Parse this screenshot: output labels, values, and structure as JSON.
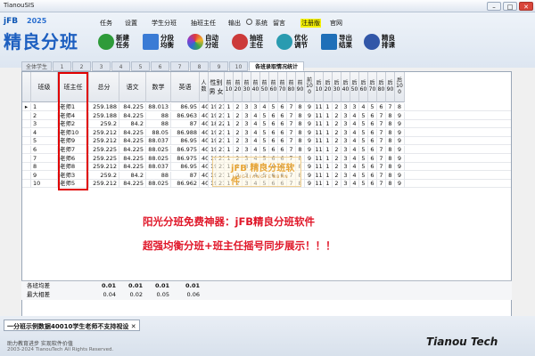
{
  "window": {
    "title": "TianouSIS",
    "min": "–",
    "max": "□",
    "close": "✕"
  },
  "logo": {
    "jfb": "jFB",
    "year": "2025",
    "name": "精良分班"
  },
  "menu": [
    "任务",
    "设置",
    "学生分班",
    "抽班主任",
    "输出",
    "系统",
    "留言",
    "注册版",
    "官网"
  ],
  "toolbar": [
    {
      "label1": "新建",
      "label2": "任务",
      "color": "#2e9b3a"
    },
    {
      "label1": "分段",
      "label2": "均衡",
      "color": "#3a7bd5"
    },
    {
      "label1": "自动",
      "label2": "分班",
      "color": "#d2a02a"
    },
    {
      "label1": "抽班",
      "label2": "主任",
      "color": "#cc3a3a"
    },
    {
      "label1": "优化",
      "label2": "调节",
      "color": "#2a9bb0"
    },
    {
      "label1": "导出",
      "label2": "结果",
      "color": "#1f6fb8"
    },
    {
      "label1": "精良",
      "label2": "排课",
      "color": "#3257a8"
    }
  ],
  "tabs": [
    "全体学生",
    "1",
    "2",
    "3",
    "4",
    "5",
    "6",
    "7",
    "8",
    "9",
    "10",
    "各班录取情况统计"
  ],
  "grid": {
    "headers": [
      "班级",
      "班主任",
      "总分",
      "语文",
      "数学",
      "英语",
      "人数",
      "性别",
      "",
      "前10",
      "前20",
      "前30",
      "前40",
      "前50",
      "前60",
      "前70",
      "前80",
      "前90",
      "前100",
      "后10",
      "后20",
      "后30",
      "后40",
      "后50",
      "后60",
      "后70",
      "后80",
      "后90",
      "后100"
    ],
    "gender": [
      "男",
      "女"
    ],
    "rows": [
      {
        "cls": "1",
        "teacher": "老师1",
        "total": "259.188",
        "yw": "84.225",
        "sx": "88.013",
        "yy": "86.95",
        "n": "40",
        "m": "19",
        "f": "21",
        "ranks": [
          "1",
          "2",
          "3",
          "3",
          "4",
          "5",
          "6",
          "7",
          "8",
          "9",
          "11",
          "1",
          "2",
          "3",
          "3",
          "4",
          "5",
          "6",
          "7",
          "8",
          "9"
        ]
      },
      {
        "cls": "2",
        "teacher": "老师4",
        "total": "259.188",
        "yw": "84.225",
        "sx": "88",
        "yy": "86.963",
        "n": "40",
        "m": "19",
        "f": "21",
        "ranks": [
          "1",
          "2",
          "3",
          "4",
          "5",
          "6",
          "6",
          "7",
          "8",
          "9",
          "11",
          "1",
          "2",
          "3",
          "4",
          "5",
          "6",
          "7",
          "8",
          "9",
          "10"
        ]
      },
      {
        "cls": "3",
        "teacher": "老师2",
        "total": "259.2",
        "yw": "84.2",
        "sx": "88",
        "yy": "87",
        "n": "40",
        "m": "18",
        "f": "22",
        "ranks": [
          "1",
          "2",
          "3",
          "4",
          "5",
          "6",
          "6",
          "7",
          "8",
          "9",
          "11",
          "1",
          "2",
          "3",
          "4",
          "5",
          "6",
          "7",
          "8",
          "9",
          "10"
        ]
      },
      {
        "cls": "4",
        "teacher": "老师10",
        "total": "259.212",
        "yw": "84.225",
        "sx": "88.05",
        "yy": "86.988",
        "n": "40",
        "m": "19",
        "f": "21",
        "ranks": [
          "1",
          "2",
          "3",
          "4",
          "5",
          "6",
          "6",
          "7",
          "8",
          "9",
          "11",
          "1",
          "2",
          "3",
          "4",
          "5",
          "6",
          "7",
          "8",
          "9",
          "10"
        ]
      },
      {
        "cls": "5",
        "teacher": "老师9",
        "total": "259.212",
        "yw": "84.225",
        "sx": "88.037",
        "yy": "86.95",
        "n": "40",
        "m": "19",
        "f": "21",
        "ranks": [
          "1",
          "2",
          "3",
          "4",
          "5",
          "6",
          "6",
          "7",
          "8",
          "9",
          "11",
          "1",
          "2",
          "3",
          "4",
          "5",
          "6",
          "7",
          "8",
          "9",
          "10"
        ]
      },
      {
        "cls": "6",
        "teacher": "老师7",
        "total": "259.225",
        "yw": "84.225",
        "sx": "88.025",
        "yy": "86.975",
        "n": "40",
        "m": "19",
        "f": "21",
        "ranks": [
          "1",
          "2",
          "3",
          "4",
          "5",
          "6",
          "6",
          "7",
          "8",
          "9",
          "11",
          "1",
          "2",
          "3",
          "4",
          "5",
          "6",
          "7",
          "8",
          "9",
          "10"
        ]
      },
      {
        "cls": "7",
        "teacher": "老师6",
        "total": "259.225",
        "yw": "84.225",
        "sx": "88.025",
        "yy": "86.975",
        "n": "40",
        "m": "19",
        "f": "21",
        "ranks": [
          "1",
          "2",
          "3",
          "4",
          "5",
          "6",
          "6",
          "7",
          "8",
          "9",
          "11",
          "1",
          "2",
          "3",
          "4",
          "5",
          "6",
          "7",
          "8",
          "9",
          "10"
        ]
      },
      {
        "cls": "8",
        "teacher": "老师8",
        "total": "259.212",
        "yw": "84.225",
        "sx": "88.037",
        "yy": "86.95",
        "n": "40",
        "m": "19",
        "f": "21",
        "ranks": [
          "1",
          "2",
          "3",
          "4",
          "5",
          "6",
          "6",
          "7",
          "8",
          "9",
          "11",
          "1",
          "2",
          "3",
          "4",
          "5",
          "6",
          "7",
          "8",
          "9",
          "10"
        ]
      },
      {
        "cls": "9",
        "teacher": "老师3",
        "total": "259.2",
        "yw": "84.2",
        "sx": "88",
        "yy": "87",
        "n": "40",
        "m": "19",
        "f": "21",
        "ranks": [
          "1",
          "2",
          "3",
          "4",
          "5",
          "6",
          "6",
          "7",
          "8",
          "9",
          "11",
          "1",
          "2",
          "3",
          "4",
          "5",
          "6",
          "7",
          "8",
          "9",
          "10"
        ]
      },
      {
        "cls": "10",
        "teacher": "老师5",
        "total": "259.212",
        "yw": "84.225",
        "sx": "88.025",
        "yy": "86.962",
        "n": "40",
        "m": "19",
        "f": "21",
        "ranks": [
          "1",
          "2",
          "3",
          "4",
          "5",
          "6",
          "6",
          "7",
          "8",
          "9",
          "11",
          "1",
          "2",
          "3",
          "4",
          "5",
          "6",
          "7",
          "8",
          "9",
          "10"
        ]
      }
    ],
    "footer": [
      {
        "label": "各班均差",
        "total": "0.01",
        "yw": "0.01",
        "sx": "0.01",
        "yy": "0.01"
      },
      {
        "label": "最大相差",
        "total": "0.04",
        "yw": "0.02",
        "sx": "0.05",
        "yy": "0.06"
      }
    ]
  },
  "watermark": {
    "title": "jFB 精良分班软件",
    "sub": "J I N G L I A N G  F E N B A N"
  },
  "overlay": {
    "line1": "阳光分班免费神器：jFB精良分班软件",
    "line2": "超强均衡分班+班主任摇号同步展示！！！"
  },
  "status": {
    "tab": "一分班示例数据40010学生老师不支持视设",
    "close": "✕",
    "slogan": "助力教育进步  实现软件价值",
    "copyright": "2003-2024 TianouTech All Rights Reserved.",
    "brand": "Tianou Tech"
  }
}
